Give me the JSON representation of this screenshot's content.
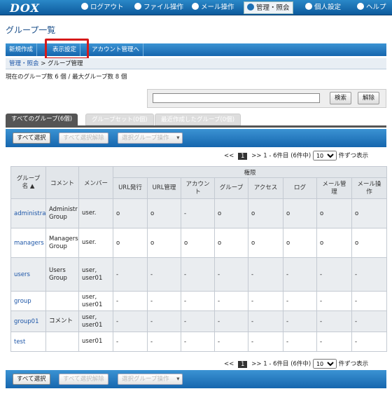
{
  "header": {
    "logo": "DOX",
    "nav": [
      {
        "label": "ログアウト",
        "icon": "logout-icon"
      },
      {
        "label": "ファイル操作",
        "icon": "file-icon"
      },
      {
        "label": "メール操作",
        "icon": "mail-icon"
      },
      {
        "label": "管理・照会",
        "icon": "admin-icon"
      },
      {
        "label": "個人設定",
        "icon": "user-icon"
      },
      {
        "label": "ヘルプ",
        "icon": "help-icon"
      }
    ]
  },
  "page_title": "グループ一覧",
  "subnav": [
    "新規作成",
    "表示設定",
    "アカウント管理へ"
  ],
  "breadcrumb": {
    "link": "管理・照会",
    "sep": " > ",
    "current": "グループ管理"
  },
  "count_text": "現在のグループ数 6 個 / 最大グループ数 8 個",
  "search": {
    "value": "",
    "search_label": "検索",
    "clear_label": "解除"
  },
  "tabs": [
    "すべてのグループ(6個)",
    "グループセット(0個)",
    "最近作成したグループ(0個)"
  ],
  "toolbar": {
    "select_all": "すべて選択",
    "deselect_all": "すべて選択解除",
    "group_ops": "選択グループ操作"
  },
  "pager": {
    "prev": "<<",
    "page": "1",
    "next": ">>",
    "range": "1 - 6件目 (6件中)",
    "per_page": "10",
    "suffix": "件ずつ表示"
  },
  "table": {
    "perm_header": "権限",
    "columns": [
      "グループ名",
      "コメント",
      "メンバー",
      "URL発行",
      "URL管理",
      "アカウント",
      "グループ",
      "アクセス",
      "ログ",
      "メール管理",
      "メール操作"
    ],
    "rows": [
      {
        "name": "administra",
        "comment": "Administr Group",
        "members": "user.",
        "perms": [
          "o",
          "o",
          "-",
          "o",
          "o",
          "o",
          "o",
          "o"
        ]
      },
      {
        "name": "managers",
        "comment": "Managers Group",
        "members": "user.",
        "perms": [
          "o",
          "o",
          "o",
          "o",
          "o",
          "o",
          "o",
          "o"
        ]
      },
      {
        "name": "users",
        "comment": "Users Group",
        "members": "user, user01",
        "perms": [
          "-",
          "-",
          "-",
          "-",
          "-",
          "-",
          "-",
          "-"
        ]
      },
      {
        "name": "group",
        "comment": "",
        "members": "user, user01",
        "perms": [
          "-",
          "-",
          "-",
          "-",
          "-",
          "-",
          "-",
          "-"
        ]
      },
      {
        "name": "group01",
        "comment": "コメント",
        "members": "user, user01",
        "perms": [
          "-",
          "-",
          "-",
          "-",
          "-",
          "-",
          "-",
          "-"
        ]
      },
      {
        "name": "test",
        "comment": "",
        "members": "user01",
        "perms": [
          "-",
          "-",
          "-",
          "-",
          "-",
          "-",
          "-",
          "-"
        ]
      }
    ]
  }
}
